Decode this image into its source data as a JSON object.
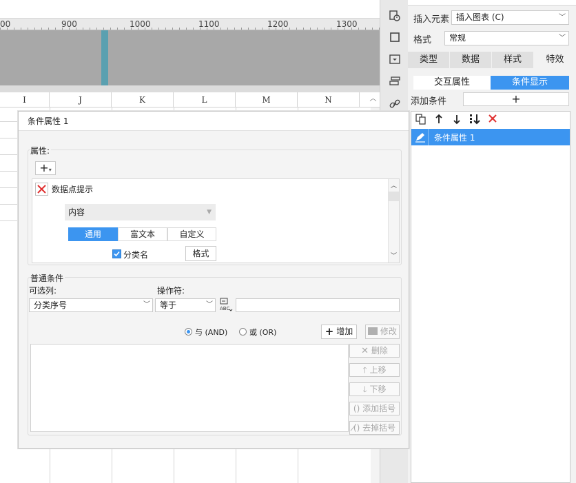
{
  "ruler": {
    "labels": [
      "00",
      "900",
      "1000",
      "1100",
      "1200",
      "1300"
    ]
  },
  "columns": [
    "I",
    "J",
    "K",
    "L",
    "M",
    "N"
  ],
  "right_panel": {
    "insert_label": "插入元素",
    "insert_value": "插入图表 (C)",
    "format_label": "格式",
    "format_value": "常规",
    "tabs": [
      "类型",
      "数据",
      "样式",
      "特效"
    ],
    "subtabs": [
      "交互属性",
      "条件显示"
    ],
    "add_condition_label": "添加条件",
    "add_condition_plus": "+",
    "condition_items": [
      "条件属性 1"
    ]
  },
  "dialog": {
    "title": "条件属性 1",
    "attributes": {
      "legend": "属性:",
      "add_icon": "+",
      "item_label": "数据点提示",
      "content_label": "内容",
      "content_tabs": [
        "通用",
        "富文本",
        "自定义"
      ],
      "checkbox_label": "分类名",
      "checkbox_checked": true,
      "format_button": "格式"
    },
    "conditions": {
      "legend": "普通条件",
      "column_label": "可选列:",
      "column_value": "分类序号",
      "operator_label": "操作符:",
      "operator_value": "等于",
      "value_input": "",
      "radio_and": "与 (AND)",
      "radio_or": "或 (OR)",
      "radio_selected": "and",
      "add_button": "增加",
      "modify_button": "修改",
      "delete_button": "删除",
      "up_button": "上移",
      "down_button": "下移",
      "add_bracket_button": "添加括号",
      "remove_bracket_button": "去掉括号"
    }
  },
  "colors": {
    "accent": "#3c95f0",
    "canvas_grey": "#a8a8a8",
    "canvas_bar": "#5aa0b0",
    "delete_red": "#e03030"
  }
}
